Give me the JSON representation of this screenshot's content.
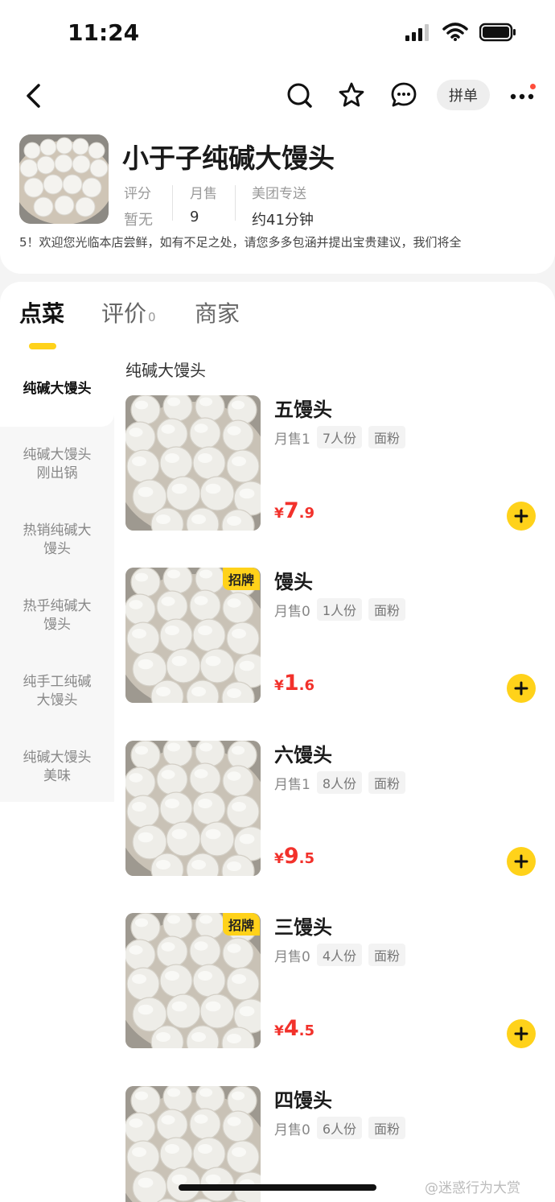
{
  "status_bar": {
    "time": "11:24",
    "icons": [
      "signal-icon",
      "wifi-icon",
      "battery-icon"
    ]
  },
  "nav": {
    "back_icon": "back-arrow-icon",
    "search_icon": "search-icon",
    "favorite_icon": "star-icon",
    "message_icon": "message-icon",
    "group_order_label": "拼单",
    "more_icon": "more-icon"
  },
  "store": {
    "name": "小于子纯碱大馒头",
    "stats": [
      {
        "label": "评分",
        "value": "暂无"
      },
      {
        "label": "月售",
        "value": "9"
      },
      {
        "label": "美团专送",
        "value": "约41分钟"
      }
    ],
    "notice": "5！欢迎您光临本店尝鲜，如有不足之处，请您多多包涵并提出宝贵建议，我们将全"
  },
  "tabs": [
    {
      "label": "点菜",
      "badge": ""
    },
    {
      "label": "评价",
      "badge": "0"
    },
    {
      "label": "商家",
      "badge": ""
    }
  ],
  "sidebar": {
    "items": [
      {
        "label": "纯碱大馒头"
      },
      {
        "label": "纯碱大馒头刚出锅"
      },
      {
        "label": "热销纯碱大馒头"
      },
      {
        "label": "热乎纯碱大馒头"
      },
      {
        "label": "纯手工纯碱大馒头"
      },
      {
        "label": "纯碱大馒头美味"
      }
    ]
  },
  "menu": {
    "section_title": "纯碱大馒头",
    "items": [
      {
        "name": "五馒头",
        "sold": "月售1",
        "portion": "7人份",
        "material": "面粉",
        "price_yen": "¥",
        "price_int": "7",
        "price_dec": ".9",
        "badge": ""
      },
      {
        "name": "馒头",
        "sold": "月售0",
        "portion": "1人份",
        "material": "面粉",
        "price_yen": "¥",
        "price_int": "1",
        "price_dec": ".6",
        "badge": "招牌"
      },
      {
        "name": "六馒头",
        "sold": "月售1",
        "portion": "8人份",
        "material": "面粉",
        "price_yen": "¥",
        "price_int": "9",
        "price_dec": ".5",
        "badge": ""
      },
      {
        "name": "三馒头",
        "sold": "月售0",
        "portion": "4人份",
        "material": "面粉",
        "price_yen": "¥",
        "price_int": "4",
        "price_dec": ".5",
        "badge": "招牌"
      },
      {
        "name": "四馒头",
        "sold": "月售0",
        "portion": "6人份",
        "material": "面粉",
        "price_yen": "",
        "price_int": "",
        "price_dec": "",
        "badge": ""
      }
    ]
  },
  "watermark": "@迷惑行为大赏",
  "colors": {
    "accent": "#ffd21a",
    "price": "#f2312b"
  }
}
